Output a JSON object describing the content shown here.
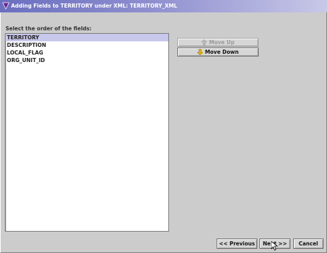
{
  "window": {
    "title": "Adding Fields to TERRITORY under XML: TERRITORY_XML"
  },
  "prompt": "Select the order of the fields:",
  "fields": [
    {
      "label": "TERRITORY",
      "selected": true
    },
    {
      "label": "DESCRIPTION",
      "selected": false
    },
    {
      "label": "LOCAL_FLAG",
      "selected": false
    },
    {
      "label": "ORG_UNIT_ID",
      "selected": false
    }
  ],
  "buttons": {
    "move_up": "Move Up",
    "move_down": "Move Down",
    "previous": "<< Previous",
    "next": "Next >>",
    "cancel": "Cancel"
  },
  "icons": {
    "title": "app-icon",
    "move_up": "arrow-up-icon",
    "move_down": "arrow-down-icon"
  },
  "colors": {
    "selection": "#c8c8ec",
    "move_arrow": "#e8b400",
    "background": "#cccccc"
  }
}
